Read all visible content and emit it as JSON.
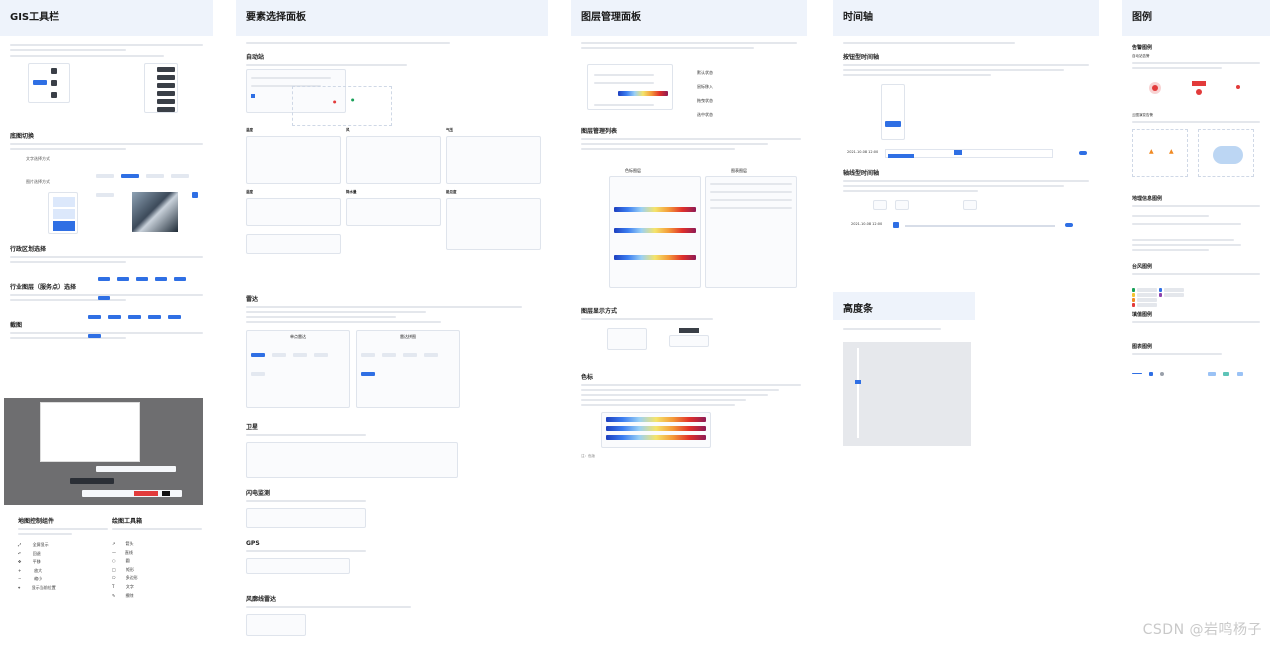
{
  "columns": {
    "gis_toolbar": {
      "title": "GIS工具栏",
      "sections": {
        "basemap_switch": "底图切换",
        "admin_select": "行政区划选择",
        "industry_select": "行业图层（服务点）选择",
        "screenshot": "截图",
        "map_controls": "地图控制组件",
        "drawing_tools": "绘图工具箱"
      },
      "labels": {
        "text_select_mode": "文字选择方式",
        "image_select_mode": "图片选择方式"
      },
      "map_controls_items": [
        "全屏显示",
        "回退",
        "平移",
        "放大",
        "缩小",
        "显示当前位置"
      ],
      "drawing_tools_items": [
        "箭头",
        "直线",
        "圆",
        "矩形",
        "多边形",
        "文字",
        "擦除"
      ]
    },
    "feature_panel": {
      "title": "要素选择面板",
      "sections": {
        "auto_station": "自动站",
        "radar": "雷达",
        "satellite": "卫星",
        "lightning": "闪电监测",
        "gps": "GPS",
        "wind_profiler": "风廓线雷达"
      },
      "sub_labels": {
        "temp": "温度",
        "humidity": "湿度",
        "precip": "降水量",
        "wind": "风",
        "pressure": "气压",
        "visibility": "能见度",
        "radar_left": "单点雷达",
        "radar_right": "雷达拼图"
      }
    },
    "layer_panel": {
      "title": "图层管理面板",
      "sections": {
        "layer_list": "图层管理列表",
        "layer_display": "图层显示方式",
        "color_scale": "色标"
      },
      "states": [
        "默认状态",
        "鼠标移入",
        "拖曳状态",
        "选中状态"
      ],
      "sub_labels": {
        "color_legend": "色标图层",
        "data_layer": "图表图层"
      },
      "footnote": "注：色版"
    },
    "timeline": {
      "title": "时间轴",
      "sections": {
        "button_timeline": "按钮型时间轴",
        "axis_timeline": "轴线型时间轴"
      },
      "times": [
        "2021.10.08 12:00",
        "2021.10.08 12:00"
      ]
    },
    "height": {
      "title": "高度条"
    },
    "legend": {
      "title": "图例",
      "sections": {
        "alarm": "告警图例",
        "geo": "地理信息图例",
        "typhoon": "台风图例",
        "fill": "填值图例",
        "chart": "图表图例"
      },
      "sub_labels": {
        "auto_alarm": "自动站告警",
        "radar_alarm": "云图演变告警"
      }
    }
  },
  "watermark": "CSDN @岩鸣杨子"
}
